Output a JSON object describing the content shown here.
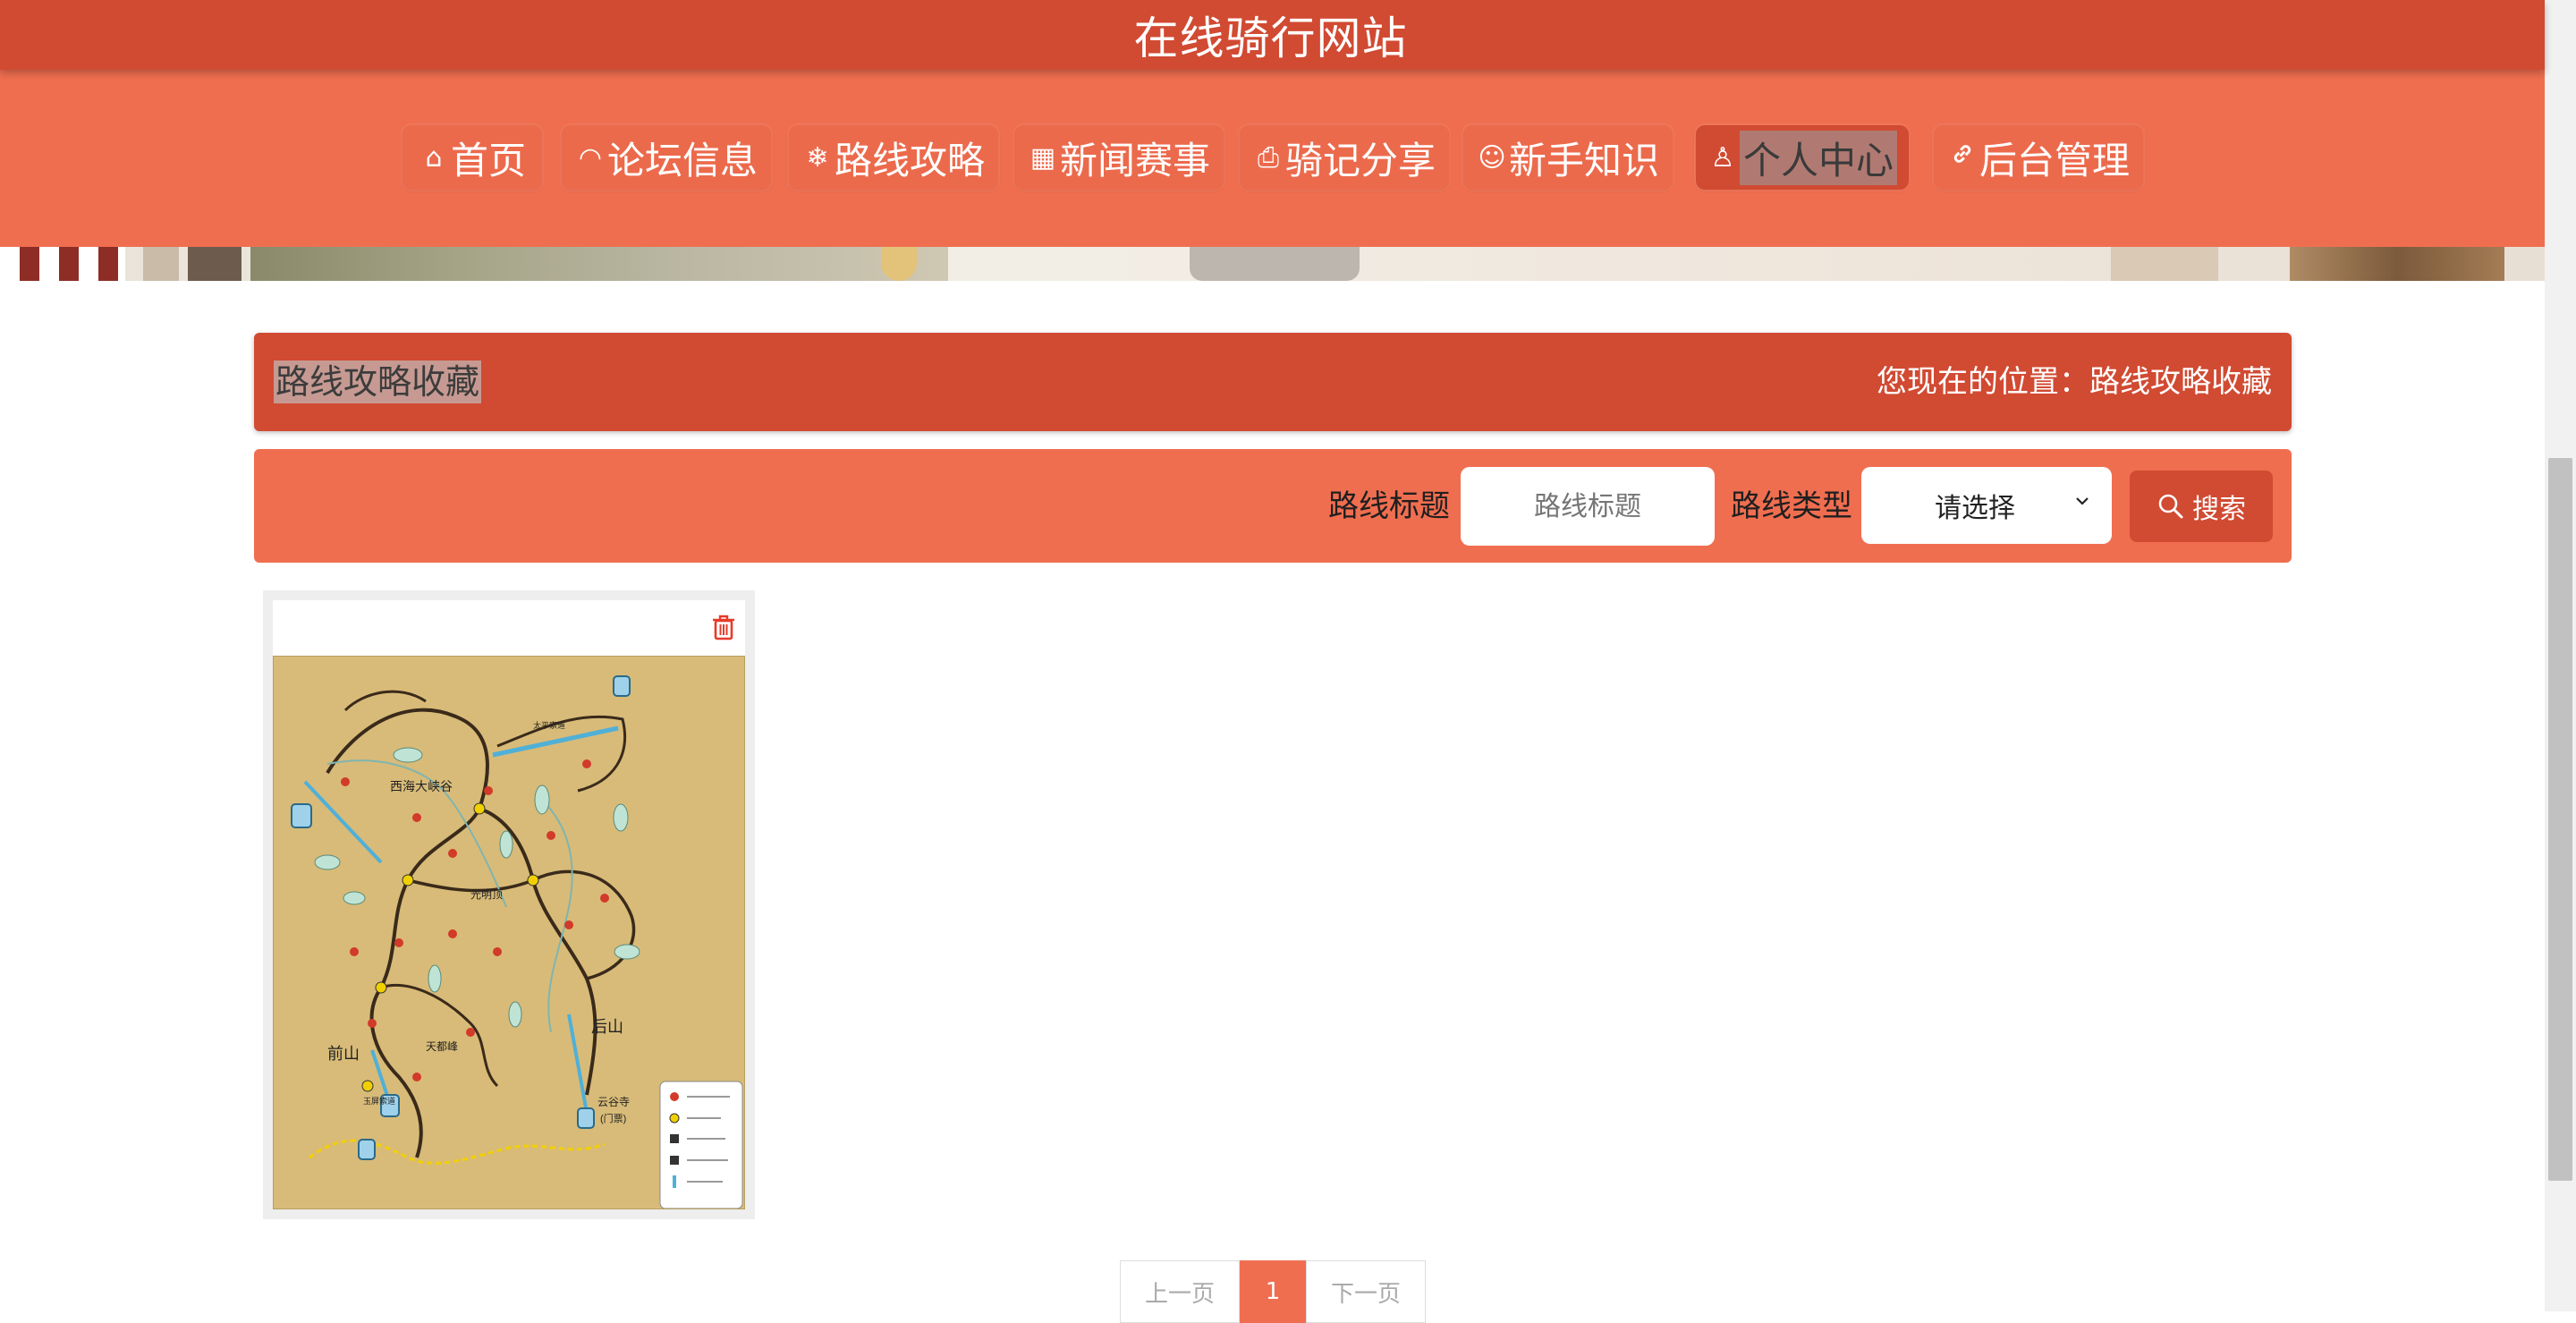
{
  "header": {
    "title": "在线骑行网站"
  },
  "nav": {
    "items": [
      {
        "label": "首页",
        "icon": "home-icon",
        "glyph": "⌂"
      },
      {
        "label": "论坛信息",
        "icon": "dashboard-icon",
        "glyph": "◠"
      },
      {
        "label": "路线攻略",
        "icon": "snowflake-icon",
        "glyph": "❄"
      },
      {
        "label": "新闻赛事",
        "icon": "grid-icon",
        "glyph": "▦"
      },
      {
        "label": "骑记分享",
        "icon": "printer-icon",
        "glyph": "⎙"
      },
      {
        "label": "新手知识",
        "icon": "smile-icon",
        "glyph": "☺"
      },
      {
        "label": "个人中心",
        "icon": "user-icon",
        "glyph": "♙"
      },
      {
        "label": "后台管理",
        "icon": "link-icon",
        "glyph": "🔗"
      }
    ],
    "active": "个人中心"
  },
  "page": {
    "title": "路线攻略收藏",
    "breadcrumb_prefix": "您现在的位置：",
    "breadcrumb_current": "路线攻略收藏"
  },
  "search": {
    "title_label": "路线标题",
    "title_placeholder": "路线标题",
    "type_label": "路线类型",
    "type_selected": "请选择",
    "button_label": "搜索"
  },
  "cards": [
    {
      "image": "route-map",
      "delete_icon": "trash-icon",
      "map_labels": [
        "西海大峡谷",
        "光明顶",
        "天都峰",
        "前山",
        "后山",
        "云谷寺",
        "(门票)",
        "太平索道",
        "玉屏索道"
      ]
    }
  ],
  "pagination": {
    "prev": "上一页",
    "current": "1",
    "next": "下一页"
  },
  "colors": {
    "primary": "#d14a32",
    "secondary": "#f06e50",
    "map_bg": "#d8bb78"
  }
}
